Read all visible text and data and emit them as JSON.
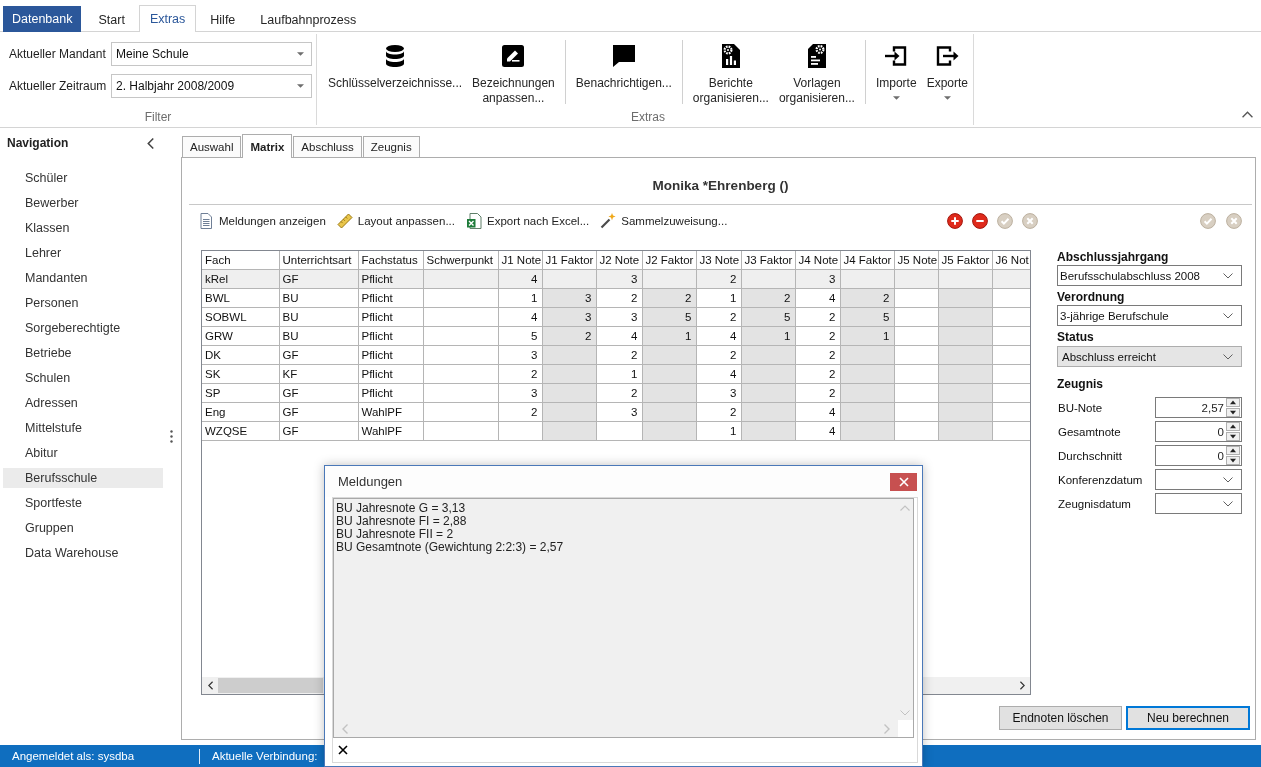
{
  "ribbon": {
    "app_button": "Datenbank",
    "tabs": [
      {
        "label": "Start",
        "selected": false
      },
      {
        "label": "Extras",
        "selected": true
      },
      {
        "label": "Hilfe",
        "selected": false
      },
      {
        "label": "Laufbahnprozess",
        "selected": false
      }
    ],
    "filter_group": {
      "label": "Filter",
      "fields": [
        {
          "label": "Aktueller Mandant",
          "value": "Meine Schule"
        },
        {
          "label": "Aktueller Zeitraum",
          "value": "2. Halbjahr 2008/2009"
        }
      ]
    },
    "extras_group": {
      "label": "Extras",
      "sections": [
        {
          "buttons": [
            {
              "label": "Schlüsselverzeichnisse...",
              "dropdown": false
            },
            {
              "label": "Bezeichnungen anpassen...",
              "dropdown": false
            }
          ]
        },
        {
          "buttons": [
            {
              "label": "Benachrichtigen...",
              "dropdown": false
            }
          ]
        },
        {
          "buttons": [
            {
              "label": "Berichte organisieren...",
              "dropdown": false
            },
            {
              "label": "Vorlagen organisieren...",
              "dropdown": false
            }
          ]
        },
        {
          "buttons": [
            {
              "label": "Importe",
              "dropdown": true
            },
            {
              "label": "Exporte",
              "dropdown": true
            }
          ]
        }
      ]
    }
  },
  "navigation": {
    "title": "Navigation",
    "items": [
      {
        "label": "Schüler",
        "selected": false
      },
      {
        "label": "Bewerber",
        "selected": false
      },
      {
        "label": "Klassen",
        "selected": false
      },
      {
        "label": "Lehrer",
        "selected": false
      },
      {
        "label": "Mandanten",
        "selected": false
      },
      {
        "label": "Personen",
        "selected": false
      },
      {
        "label": "Sorgeberechtigte",
        "selected": false
      },
      {
        "label": "Betriebe",
        "selected": false
      },
      {
        "label": "Schulen",
        "selected": false
      },
      {
        "label": "Adressen",
        "selected": false
      },
      {
        "label": "Mittelstufe",
        "selected": false
      },
      {
        "label": "Abitur",
        "selected": false
      },
      {
        "label": "Berufsschule",
        "selected": true
      },
      {
        "label": "Sportfeste",
        "selected": false
      },
      {
        "label": "Gruppen",
        "selected": false
      },
      {
        "label": "Data Warehouse",
        "selected": false
      }
    ]
  },
  "tabs": [
    {
      "label": "Auswahl",
      "selected": false
    },
    {
      "label": "Matrix",
      "selected": true
    },
    {
      "label": "Abschluss",
      "selected": false
    },
    {
      "label": "Zeugnis",
      "selected": false
    }
  ],
  "record": {
    "title": "Monika *Ehrenberg ()",
    "toolbar": [
      {
        "label": "Meldungen anzeigen"
      },
      {
        "label": "Layout anpassen..."
      },
      {
        "label": "Export nach Excel..."
      },
      {
        "label": "Sammelzuweisung..."
      }
    ],
    "row_actions": [
      {
        "disabled": false
      },
      {
        "disabled": false
      },
      {
        "disabled": true
      },
      {
        "disabled": true
      }
    ],
    "form_actions": [
      {
        "disabled": true
      },
      {
        "disabled": true
      }
    ],
    "grid": {
      "columns": [
        {
          "label": "Fach",
          "readonly": false
        },
        {
          "label": "Unterrichtsart",
          "readonly": false
        },
        {
          "label": "Fachstatus",
          "readonly": false
        },
        {
          "label": "Schwerpunkt",
          "readonly": false
        },
        {
          "label": "J1 Note",
          "readonly": false
        },
        {
          "label": "J1 Faktor",
          "readonly": true
        },
        {
          "label": "J2 Note",
          "readonly": false
        },
        {
          "label": "J2 Faktor",
          "readonly": true
        },
        {
          "label": "J3 Note",
          "readonly": false
        },
        {
          "label": "J3 Faktor",
          "readonly": true
        },
        {
          "label": "J4 Note",
          "readonly": false
        },
        {
          "label": "J4 Faktor",
          "readonly": true
        },
        {
          "label": "J5 Note",
          "readonly": false
        },
        {
          "label": "J5 Faktor",
          "readonly": true
        },
        {
          "label": "J6 Not",
          "readonly": false
        }
      ],
      "rows": [
        {
          "selected": true,
          "cells": [
            "kRel",
            "GF",
            "Pflicht",
            null,
            "4",
            null,
            "3",
            null,
            "2",
            null,
            "3",
            null,
            null,
            null,
            null
          ]
        },
        {
          "selected": false,
          "cells": [
            "BWL",
            "BU",
            "Pflicht",
            null,
            "1",
            "3",
            "2",
            "2",
            "1",
            "2",
            "4",
            "2",
            null,
            null,
            null
          ]
        },
        {
          "selected": false,
          "cells": [
            "SOBWL",
            "BU",
            "Pflicht",
            null,
            "4",
            "3",
            "3",
            "5",
            "2",
            "5",
            "2",
            "5",
            null,
            null,
            null
          ]
        },
        {
          "selected": false,
          "cells": [
            "GRW",
            "BU",
            "Pflicht",
            null,
            "5",
            "2",
            "4",
            "1",
            "4",
            "1",
            "2",
            "1",
            null,
            null,
            null
          ]
        },
        {
          "selected": false,
          "cells": [
            "DK",
            "GF",
            "Pflicht",
            null,
            "3",
            null,
            "2",
            null,
            "2",
            null,
            "2",
            null,
            null,
            null,
            null
          ]
        },
        {
          "selected": false,
          "cells": [
            "SK",
            "KF",
            "Pflicht",
            null,
            "2",
            null,
            "1",
            null,
            "4",
            null,
            "2",
            null,
            null,
            null,
            null
          ]
        },
        {
          "selected": false,
          "cells": [
            "SP",
            "GF",
            "Pflicht",
            null,
            "3",
            null,
            "2",
            null,
            "3",
            null,
            "2",
            null,
            null,
            null,
            null
          ]
        },
        {
          "selected": false,
          "cells": [
            "Eng",
            "GF",
            "WahlPF",
            null,
            "2",
            null,
            "3",
            null,
            "2",
            null,
            "4",
            null,
            null,
            null,
            null
          ]
        },
        {
          "selected": false,
          "cells": [
            "WZQSE",
            "GF",
            "WahlPF",
            null,
            null,
            null,
            null,
            null,
            "1",
            null,
            "4",
            null,
            null,
            null,
            null
          ]
        }
      ]
    },
    "form": {
      "selects": [
        {
          "label": "Abschlussjahrgang",
          "value": "Berufsschulabschluss 2008",
          "disabled": false
        },
        {
          "label": "Verordnung",
          "value": "3-jährige Berufschule",
          "disabled": false
        },
        {
          "label": "Status",
          "value": "Abschluss erreicht",
          "disabled": true
        }
      ],
      "section_title": "Zeugnis",
      "fields": [
        {
          "kind": "spin",
          "label": "BU-Note",
          "value": "2,57"
        },
        {
          "kind": "spin",
          "label": "Gesamtnote",
          "value": "0"
        },
        {
          "kind": "spin",
          "label": "Durchschnitt",
          "value": "0"
        },
        {
          "kind": "date",
          "label": "Konferenzdatum"
        },
        {
          "kind": "date",
          "label": "Zeugnisdatum"
        }
      ]
    },
    "buttons": [
      {
        "label": "Endnoten löschen",
        "focused": false
      },
      {
        "label": "Neu berechnen",
        "focused": true
      }
    ]
  },
  "status_bar": {
    "items": [
      "Angemeldet als: sysdba",
      "Aktuelle Verbindung:"
    ]
  },
  "dialog": {
    "title": "Meldungen",
    "lines": [
      "BU Jahresnote G = 3,13",
      "BU Jahresnote FI = 2,88",
      "BU Jahresnote FII = 2",
      "BU Gesamtnote (Gewichtung 2:2:3) = 2,57"
    ]
  }
}
